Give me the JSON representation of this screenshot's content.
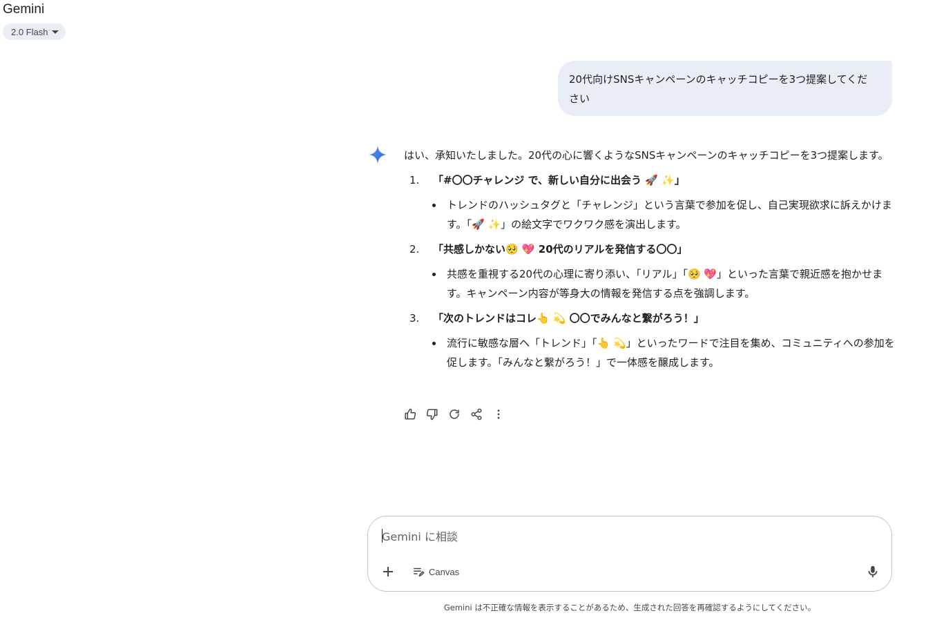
{
  "header": {
    "app_title": "Gemini",
    "model_label": "2.0 Flash"
  },
  "user_message": "20代向けSNSキャンペーンのキャッチコピーを3つ提案してください",
  "response": {
    "intro": "はい、承知いたしました。20代の心に響くようなSNSキャンペーンのキャッチコピーを3つ提案します。",
    "items": [
      {
        "number": "1.",
        "title": "「#〇〇チャレンジ で、新しい自分に出会う 🚀 ✨」",
        "detail": "トレンドのハッシュタグと「チャレンジ」という言葉で参加を促し、自己実現欲求に訴えかけます。「🚀 ✨」の絵文字でワクワク感を演出します。"
      },
      {
        "number": "2.",
        "title": "「共感しかない🥺 💖 20代のリアルを発信する〇〇」",
        "detail": "共感を重視する20代の心理に寄り添い、「リアル」「🥺 💖」といった言葉で親近感を抱かせます。キャンペーン内容が等身大の情報を発信する点を強調します。"
      },
      {
        "number": "3.",
        "title": "「次のトレンドはコレ👆 💫 〇〇でみんなと繋がろう！」",
        "detail": "流行に敏感な層へ「トレンド」「👆 💫」といったワードで注目を集め、コミュニティへの参加を促します。「みんなと繋がろう！」で一体感を醸成します。"
      }
    ]
  },
  "actions": {
    "icons": [
      "thumbs-up-icon",
      "thumbs-down-icon",
      "regenerate-icon",
      "share-icon",
      "more-icon"
    ]
  },
  "composer": {
    "placeholder": "Gemini に相談",
    "canvas_label": "Canvas"
  },
  "footer": {
    "disclaimer": "Gemini は不正確な情報を表示することがあるため、生成された回答を再確認するようにしてください。"
  },
  "colors": {
    "bubble": "#e9eef6",
    "spark_blue": "#3b78e7",
    "icon_gray": "#444746"
  }
}
